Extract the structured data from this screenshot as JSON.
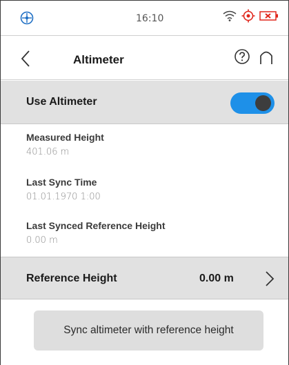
{
  "status_bar": {
    "time": "16:10",
    "icons": [
      "satellite-icon",
      "wifi-icon",
      "gps-target-icon",
      "battery-empty-icon"
    ],
    "accent_red": "#e0261b"
  },
  "header": {
    "title": "Altimeter",
    "back_icon": "chevron-left-icon",
    "help_icon": "help-circle-icon",
    "home_icon": "home-icon"
  },
  "settings": {
    "use_altimeter": {
      "label": "Use Altimeter",
      "enabled": true,
      "switch_color": "#1e90e8"
    },
    "measured_height": {
      "label": "Measured Height",
      "value": "401.06 m"
    },
    "last_sync_time": {
      "label": "Last Sync Time",
      "value": "01.01.1970 1:00"
    },
    "last_synced_reference": {
      "label": "Last Synced Reference Height",
      "value": "0.00 m"
    },
    "reference_height": {
      "label": "Reference Height",
      "value": "0.00 m"
    }
  },
  "actions": {
    "sync_button_label": "Sync altimeter with reference height"
  }
}
